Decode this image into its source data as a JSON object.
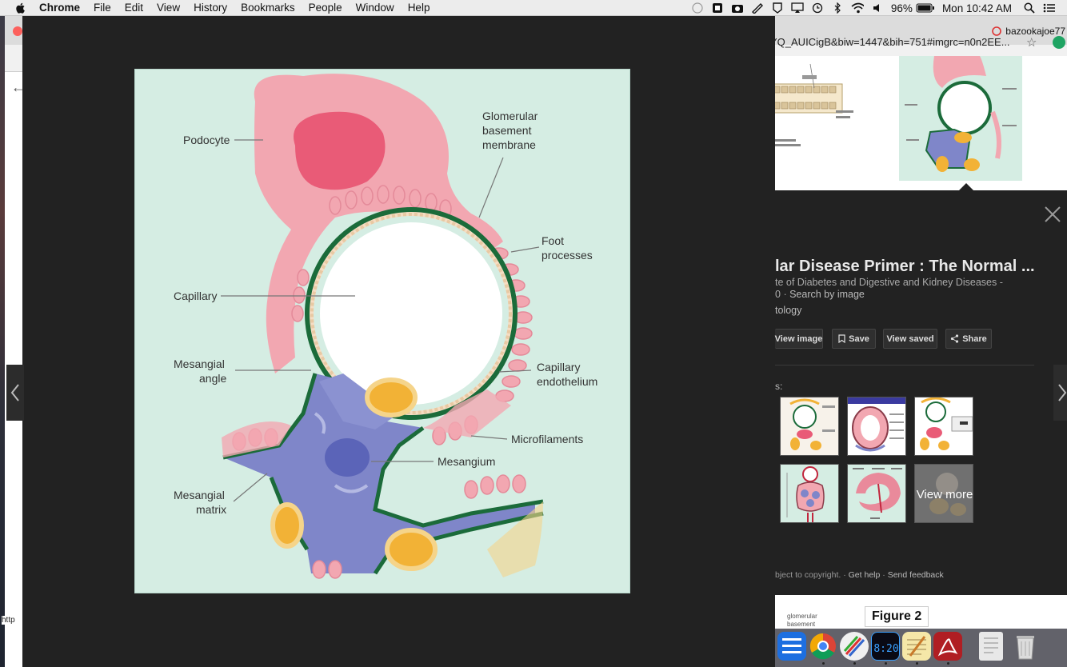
{
  "menubar": {
    "app": "Chrome",
    "menus": [
      "File",
      "Edit",
      "View",
      "History",
      "Bookmarks",
      "People",
      "Window",
      "Help"
    ],
    "battery": "96%",
    "clock": "Mon 10:42 AM"
  },
  "browser": {
    "profile": "bazookajoe77",
    "url": "YQ_AUICigB&biw=1447&bih=751#imgrc=n0n2EE..."
  },
  "figure": {
    "labels": {
      "podocyte": "Podocyte",
      "gbm_1": "Glomerular",
      "gbm_2": "basement",
      "gbm_3": "membrane",
      "foot_1": "Foot",
      "foot_2": "processes",
      "capillary": "Capillary",
      "mes_angle_1": "Mesangial",
      "mes_angle_2": "angle",
      "endo_1": "Capillary",
      "endo_2": "endothelium",
      "microfilaments": "Microfilaments",
      "mesangium": "Mesangium",
      "matrix_1": "Mesangial",
      "matrix_2": "matrix"
    }
  },
  "panel": {
    "title": "lar Disease Primer : The Normal ...",
    "source": "te of Diabetes and Digestive and Kidney Diseases -",
    "source_line2_prefix": "0",
    "search_by_image": "Search by image",
    "category": "tology",
    "buttons": {
      "view_image": "View image",
      "save": "Save",
      "view_saved": "View saved",
      "share": "Share"
    },
    "related_label": "s:",
    "view_more": "View more",
    "footer": {
      "copyright": "bject to copyright.",
      "get_help": "Get help",
      "send_feedback": "Send feedback"
    }
  },
  "below": {
    "small_1": "glomerular",
    "small_2": "basement",
    "figure_label": "Figure 2"
  },
  "left_edge": {
    "text": "http"
  },
  "dock": {
    "clock": "8:20"
  }
}
